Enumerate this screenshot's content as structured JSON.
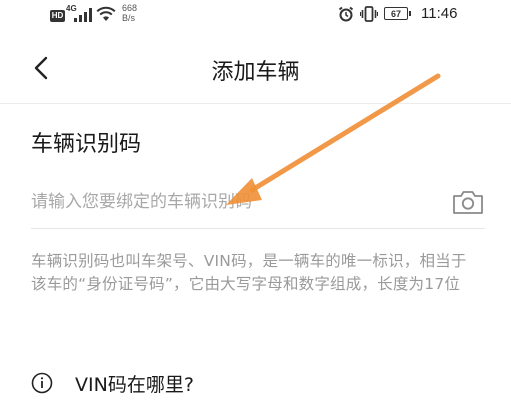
{
  "status_bar": {
    "hd_badge": "HD",
    "network": "4G",
    "speed_value": "668",
    "speed_unit": "B/s",
    "battery": "67",
    "time": "11:46"
  },
  "header": {
    "title": "添加车辆"
  },
  "vin_section": {
    "title": "车辆识别码",
    "input_value": "",
    "input_placeholder": "请输入您要绑定的车辆识别码",
    "description": "车辆识别码也叫车架号、VIN码，是一辆车的唯一标识，相当于该车的“身份证号码”，它由大写字母和数字组成，长度为17位"
  },
  "help": {
    "label": "VIN码在哪里?"
  },
  "icons": {
    "back": "chevron-left-icon",
    "camera": "camera-icon",
    "info": "info-circle-icon",
    "alarm": "alarm-icon",
    "vibrate": "vibrate-icon",
    "wifi": "wifi-icon",
    "signal": "signal-icon"
  },
  "colors": {
    "annotation_arrow": "#f0913a",
    "placeholder": "#a8a8a8",
    "description": "#9a9a9a"
  }
}
